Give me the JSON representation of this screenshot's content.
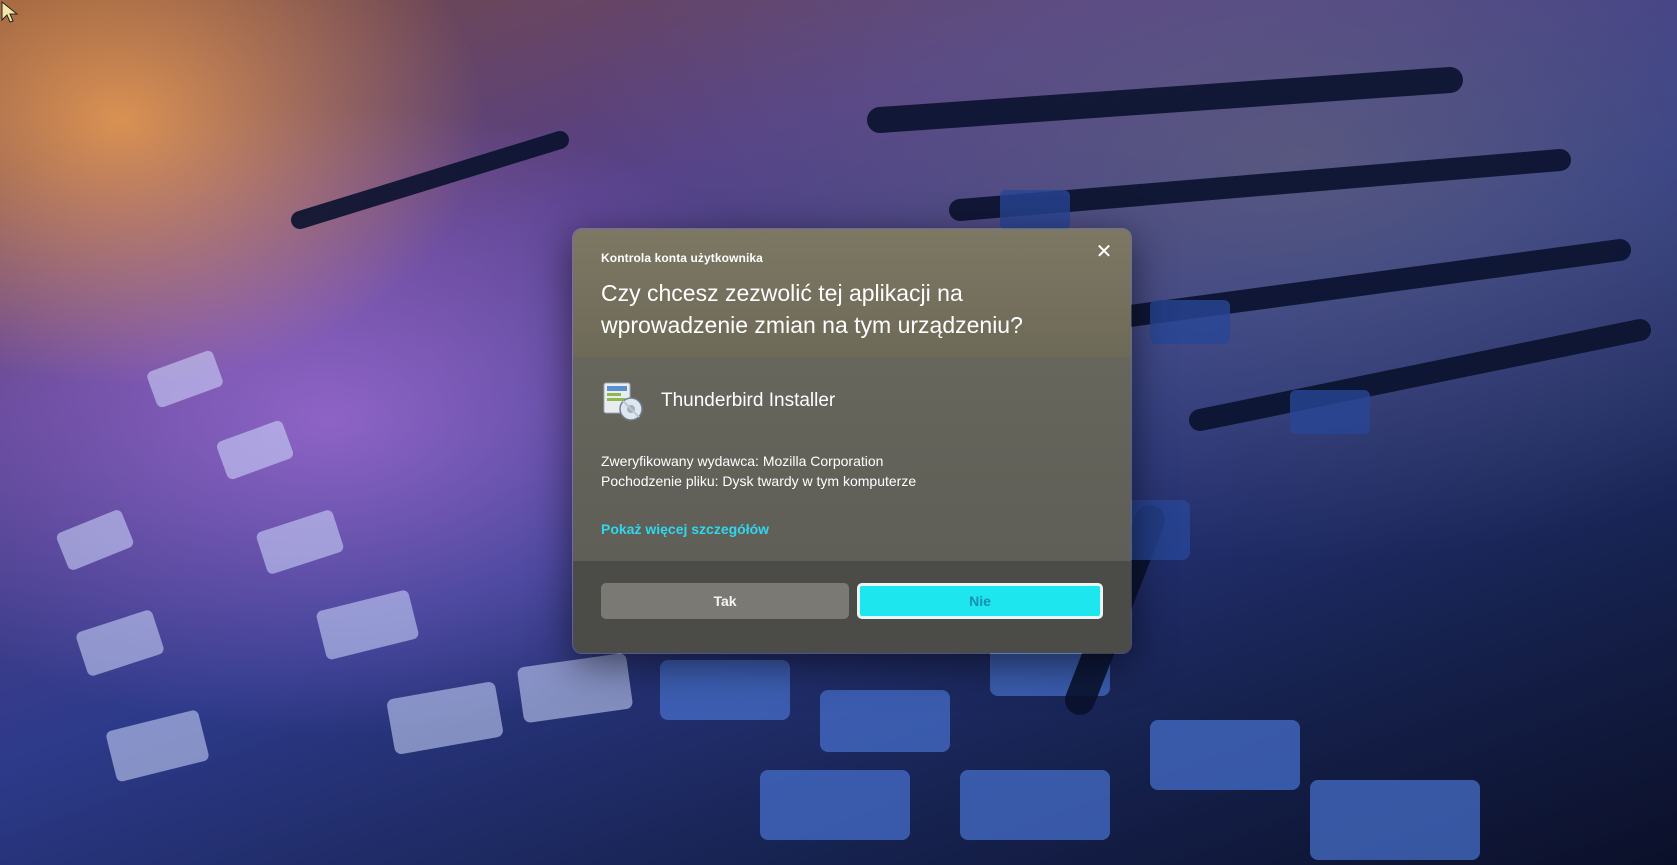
{
  "dialog": {
    "caption": "Kontrola konta użytkownika",
    "close_glyph": "✕",
    "question_line1": "Czy chcesz zezwolić tej aplikacji na",
    "question_line2": "wprowadzenie zmian na tym urządzeniu?",
    "app_name": "Thunderbird Installer",
    "app_icon": "installer-icon",
    "publisher": "Zweryfikowany wydawca: Mozilla Corporation",
    "origin": "Pochodzenie pliku: Dysk twardy w tym komputerze",
    "details_link": "Pokaż więcej szczegółów",
    "yes_label": "Tak",
    "no_label": "Nie",
    "colors": {
      "header": "#7d7864",
      "body": "#67665c",
      "footer": "#4b4b48",
      "link": "#2fd7ef",
      "primary_button": "#1ee6ee"
    }
  },
  "desktop": {
    "cursor_icon": "mouse-pointer-icon"
  }
}
